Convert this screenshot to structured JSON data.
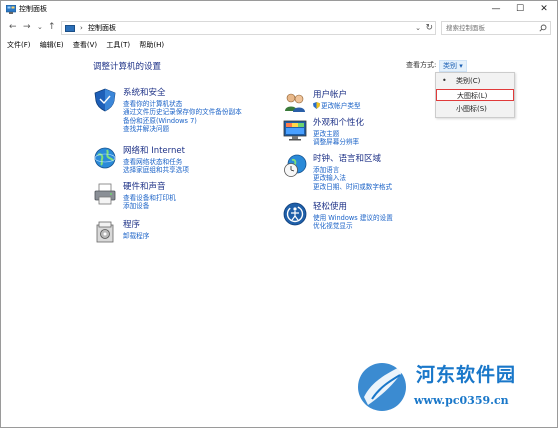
{
  "window": {
    "title": "控制面板",
    "controls": {
      "minimize": "—",
      "maximize": "☐",
      "close": "✕"
    }
  },
  "address": {
    "back": "←",
    "forward": "→",
    "recent": "⌄",
    "up": "↑",
    "separator": "›",
    "breadcrumb": "控制面板",
    "dropdown": "⌄",
    "refresh": "↻",
    "search_placeholder": "搜索控制面板"
  },
  "menu": [
    "文件(F)",
    "编辑(E)",
    "查看(V)",
    "工具(T)",
    "帮助(H)"
  ],
  "main": {
    "heading": "调整计算机的设置",
    "view_by_label": "查看方式:",
    "view_by_value": "类别 ▾",
    "view_options": [
      {
        "bullet": "•",
        "label": "类别(C)"
      },
      {
        "bullet": "",
        "label": "大图标(L)"
      },
      {
        "bullet": "",
        "label": "小图标(S)"
      }
    ],
    "left": [
      {
        "title": "系统和安全",
        "icon": "shield-icon",
        "links": [
          "查看你的计算机状态",
          "通过文件历史记录保存你的文件备份副本",
          "备份和还原(Windows 7)",
          "查找并解决问题"
        ]
      },
      {
        "title": "网络和 Internet",
        "icon": "globe-network-icon",
        "links": [
          "查看网络状态和任务",
          "选择家庭组和共享选项"
        ]
      },
      {
        "title": "硬件和声音",
        "icon": "printer-icon",
        "links": [
          "查看设备和打印机",
          "添加设备"
        ]
      },
      {
        "title": "程序",
        "icon": "programs-icon",
        "links": [
          "卸载程序"
        ]
      }
    ],
    "right": [
      {
        "title": "用户帐户",
        "icon": "users-icon",
        "links": [
          "更改帐户类型"
        ]
      },
      {
        "title": "外观和个性化",
        "icon": "monitor-icon",
        "links": [
          "更改主题",
          "调整屏幕分辨率"
        ]
      },
      {
        "title": "时钟、语言和区域",
        "icon": "clock-globe-icon",
        "links": [
          "添加语言",
          "更改输入法",
          "更改日期、时间或数字格式"
        ]
      },
      {
        "title": "轻松使用",
        "icon": "ease-of-access-icon",
        "links": [
          "使用 Windows 建议的设置",
          "优化视觉显示"
        ]
      }
    ]
  },
  "watermark": {
    "title": "河东软件园",
    "url": "www.pc0359.cn"
  }
}
